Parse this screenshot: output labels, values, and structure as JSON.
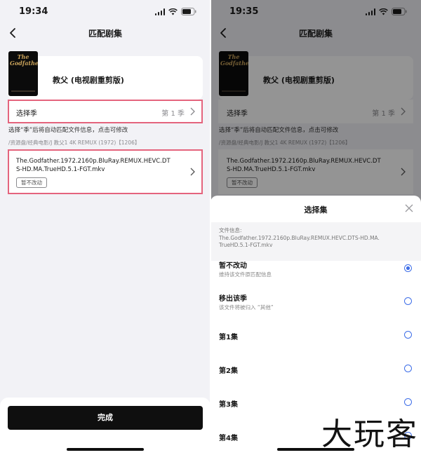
{
  "left": {
    "status_time": "19:34",
    "nav_title": "匹配剧集",
    "poster_text": "The Godfather",
    "show_title": "教父 (电视剧重剪版)",
    "season_label": "选择季",
    "season_value": "第 1 季",
    "hint": "选择“季”后将自动匹配文件信息，点击可修改",
    "path": "/资源盘/经典电影/J 教父1 4K REMUX (1972)【1206】",
    "file_name": "The.Godfather.1972.2160p.BluRay.REMUX.HEVC.DTS-HD.MA.TrueHD.5.1-FGT.mkv",
    "file_tag": "暂不改动",
    "done_label": "完成"
  },
  "right": {
    "status_time": "19:35",
    "sheet_title": "选择集",
    "info_label": "文件信息:",
    "info_file": "The.Godfather.1972.2160p.BluRay.REMUX.HEVC.DTS-HD.MA.TrueHD.5.1-FGT.mkv",
    "options": [
      {
        "title": "暂不改动",
        "subtitle": "维持该文件原匹配信息",
        "selected": true
      },
      {
        "title": "移出该季",
        "subtitle": "该文件将被归入 “其他”",
        "selected": false
      },
      {
        "title": "第1集",
        "subtitle": "",
        "selected": false
      },
      {
        "title": "第2集",
        "subtitle": "",
        "selected": false
      },
      {
        "title": "第3集",
        "subtitle": "",
        "selected": false
      },
      {
        "title": "第4集",
        "subtitle": "",
        "selected": false
      }
    ]
  },
  "watermark": "大玩客",
  "colors": {
    "highlight": "#e4647d",
    "accent": "#3e6ee8",
    "button": "#0f0f0f"
  }
}
